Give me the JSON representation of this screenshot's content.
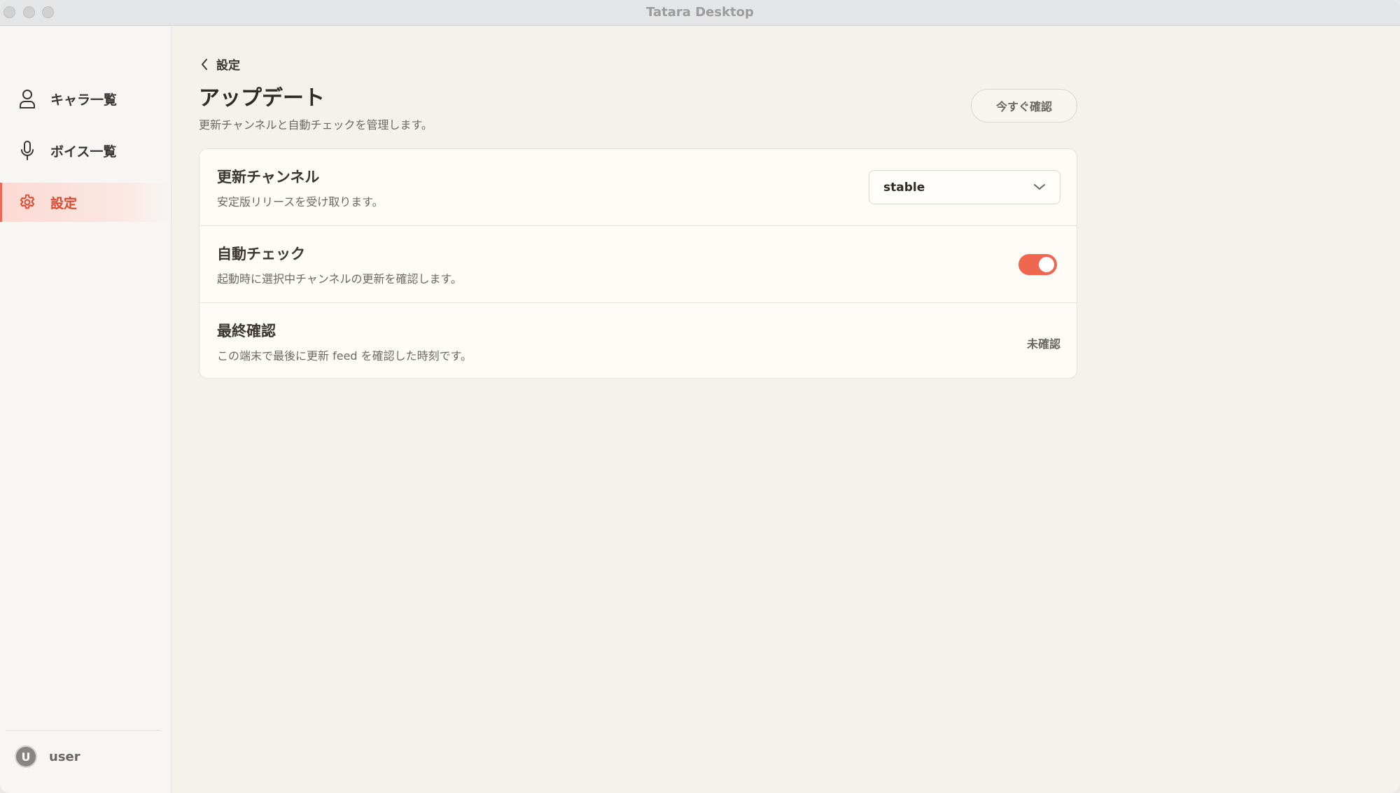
{
  "window": {
    "title": "Tatara Desktop"
  },
  "sidebar": {
    "items": [
      {
        "label": "キャラ一覧",
        "icon": "person-icon"
      },
      {
        "label": "ボイス一覧",
        "icon": "microphone-icon"
      },
      {
        "label": "設定",
        "icon": "gear-icon",
        "active": true
      }
    ],
    "user": {
      "avatar_letter": "U",
      "name": "user"
    }
  },
  "header": {
    "back_label": "設定",
    "title": "アップデート",
    "subtitle": "更新チャンネルと自動チェックを管理します。",
    "check_now_label": "今すぐ確認"
  },
  "settings": {
    "channel": {
      "title": "更新チャンネル",
      "description": "安定版リリースを受け取ります。",
      "selected": "stable"
    },
    "auto_check": {
      "title": "自動チェック",
      "description": "起動時に選択中チャンネルの更新を確認します。",
      "enabled": true
    },
    "last_check": {
      "title": "最終確認",
      "description": "この端末で最後に更新 feed を確認した時刻です。",
      "value": "未確認"
    }
  },
  "colors": {
    "accent": "#f0674f",
    "active_text": "#e1472e",
    "background": "#f5f2ec"
  }
}
